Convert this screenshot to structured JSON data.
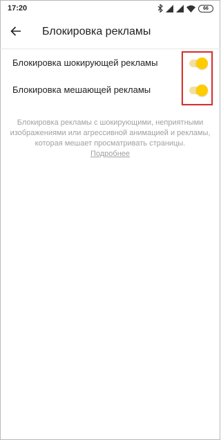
{
  "status_bar": {
    "time": "17:20",
    "battery": "66",
    "icons": [
      "bluetooth-icon",
      "signal-icon",
      "signal-icon",
      "wifi-icon",
      "battery-icon"
    ]
  },
  "header": {
    "back_icon": "arrow-left-icon",
    "title": "Блокировка рекламы"
  },
  "settings": [
    {
      "label": "Блокировка шокирующей рекламы",
      "enabled": true
    },
    {
      "label": "Блокировка мешающей рекламы",
      "enabled": true
    }
  ],
  "description": {
    "text": "Блокировка рекламы с шокирующими, неприятными изображениями или агрессивной анимацией и рекламы, которая мешает просматривать страницы.",
    "link": "Подробнее"
  },
  "colors": {
    "toggle_thumb": "#ffcc00",
    "toggle_track": "#f3dfa0",
    "highlight": "#d9302c"
  }
}
